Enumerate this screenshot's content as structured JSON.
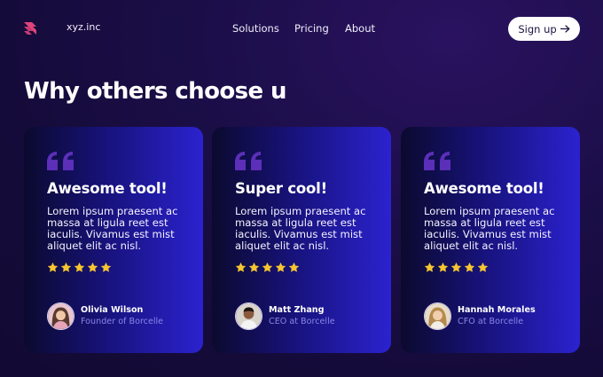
{
  "nav": {
    "brand": "xyz.inc",
    "links": [
      "Solutions",
      "Pricing",
      "About"
    ],
    "signup_label": "Sign up"
  },
  "heading": "Why others choose u",
  "testimonials": [
    {
      "title": "Awesome tool!",
      "body": "Lorem ipsum praesent ac massa at ligula reet est iaculis. Vivamus est mist aliquet elit ac nisl.",
      "rating": 5,
      "name": "Olivia Wilson",
      "role": "Founder of Borcelle"
    },
    {
      "title": "Super cool!",
      "body": "Lorem ipsum praesent ac massa at ligula reet est iaculis. Vivamus est mist aliquet elit ac nisl.",
      "rating": 5,
      "name": "Matt Zhang",
      "role": "CEO at Borcelle"
    },
    {
      "title": "Awesome tool!",
      "body": "Lorem ipsum praesent ac massa at ligula reet est iaculis. Vivamus est mist aliquet elit ac nisl.",
      "rating": 5,
      "name": "Hannah Morales",
      "role": "CFO at Borcelle"
    }
  ],
  "icons": {
    "logo": "stacked-chevron-logo-icon",
    "quote": "quote-icon",
    "star": "star-icon",
    "arrow": "arrow-right-icon"
  },
  "colors": {
    "accent_star": "#f5c531",
    "quote_mark": "#5b2fb8",
    "role_text": "#8a86e8",
    "logo": "#e0447a"
  }
}
